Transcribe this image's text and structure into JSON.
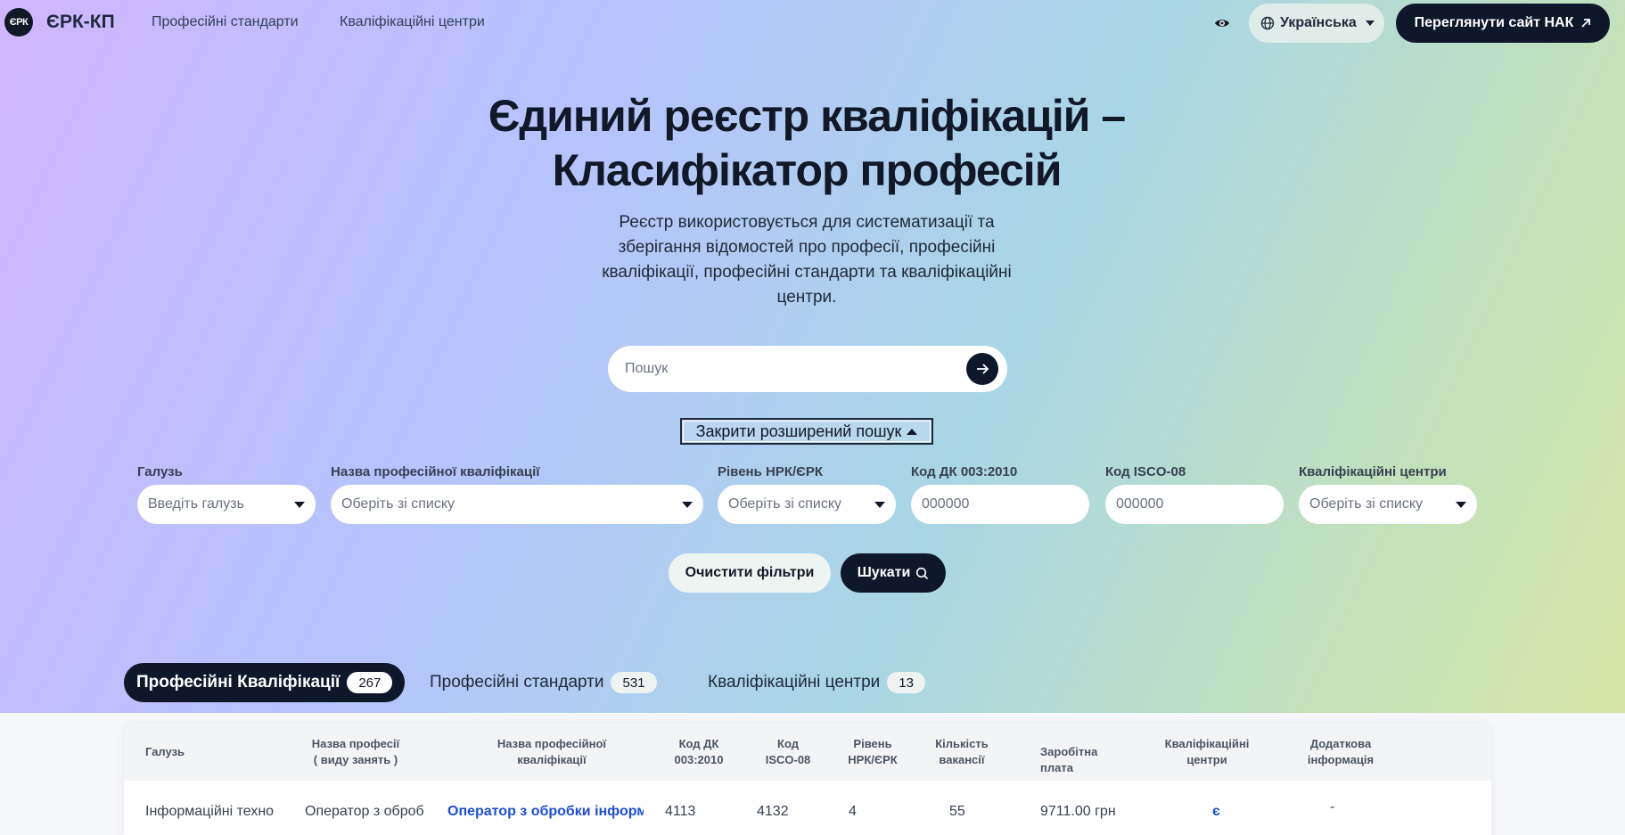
{
  "header": {
    "logo_badge": "ЄРК",
    "logo_text": "ЄРК-КП",
    "nav": [
      "Професійні стандарти",
      "Кваліфікаційні центри"
    ],
    "language": "Українська",
    "nak_button": "Переглянути сайт НАК"
  },
  "hero": {
    "title_line1": "Єдиний реєстр кваліфікацій –",
    "title_line2": "Класифікатор професій",
    "subtitle": "Реєстр використовується для систематизації та зберігання відомостей про професії, професійні кваліфікації, професійні стандарти та кваліфікаційні центри."
  },
  "search": {
    "placeholder": "Пошук",
    "advanced_toggle": "Закрити розширений пошук"
  },
  "filters": [
    {
      "label": "Галузь",
      "placeholder": "Введіть галузь"
    },
    {
      "label": "Назва професійної кваліфікації",
      "placeholder": "Оберіть зі списку"
    },
    {
      "label": "Рівень НРК/ЄРК",
      "placeholder": "Оберіть зі списку"
    },
    {
      "label": "Код ДК 003:2010",
      "placeholder": "000000"
    },
    {
      "label": "Код ISCO-08",
      "placeholder": "000000"
    },
    {
      "label": "Кваліфікаційні центри",
      "placeholder": "Оберіть зі списку"
    }
  ],
  "actions": {
    "clear": "Очистити фільтри",
    "find": "Шукати"
  },
  "tabs": [
    {
      "label": "Професійні Кваліфікації",
      "count": "267",
      "active": true
    },
    {
      "label": "Професійні стандарти",
      "count": "531",
      "active": false
    },
    {
      "label": "Кваліфікаційні центри",
      "count": "13",
      "active": false
    }
  ],
  "table": {
    "headers": [
      "Галузь",
      "Назва професії\n( виду занять )",
      "Назва професійної\nкваліфікації",
      "Код ДК\n003:2010",
      "Код\nISCO-08",
      "Рівень\nНРК/ЄРК",
      "Кількість\nвакансії",
      "Заробітна плата",
      "Кваліфікаційні\nцентри",
      "Додаткова\nінформація"
    ],
    "rows": [
      [
        "Інформаційні техно",
        "Оператор з оброб",
        "Оператор з обробки інформ",
        "4113",
        "4132",
        "4",
        "55",
        "9711.00 грн",
        "є",
        "-"
      ]
    ]
  },
  "colors": {
    "primary_dark": "#0f172a",
    "link": "#1d4ed8"
  }
}
